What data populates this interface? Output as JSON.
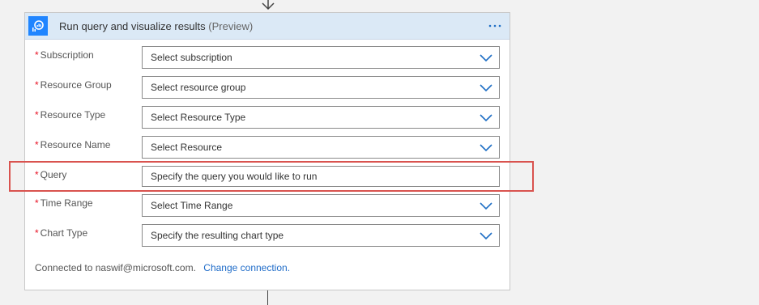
{
  "card": {
    "title": "Run query and visualize results",
    "title_suffix": "(Preview)",
    "more_icon": "ellipsis-icon",
    "app_icon": "log-analytics-icon"
  },
  "fields": [
    {
      "label": "Subscription",
      "required_mark": "*",
      "value": "Select subscription",
      "type": "dropdown"
    },
    {
      "label": "Resource Group",
      "required_mark": "*",
      "value": "Select resource group",
      "type": "dropdown"
    },
    {
      "label": "Resource Type",
      "required_mark": "*",
      "value": "Select Resource Type",
      "type": "dropdown"
    },
    {
      "label": "Resource Name",
      "required_mark": "*",
      "value": "Select Resource",
      "type": "dropdown"
    },
    {
      "label": "Query",
      "required_mark": "*",
      "placeholder": "Specify the query you would like to run",
      "type": "text"
    },
    {
      "label": "Time Range",
      "required_mark": "*",
      "value": "Select Time Range",
      "type": "dropdown"
    },
    {
      "label": "Chart Type",
      "required_mark": "*",
      "value": "Specify the resulting chart type",
      "type": "dropdown"
    }
  ],
  "footer": {
    "connected_text": "Connected to naswif@microsoft.com.",
    "change_link": "Change connection."
  },
  "colors": {
    "header_bg": "#dbe9f6",
    "accent": "#1f85ff",
    "required": "#e81123",
    "link": "#1e6bc8",
    "highlight": "#d9534f"
  }
}
